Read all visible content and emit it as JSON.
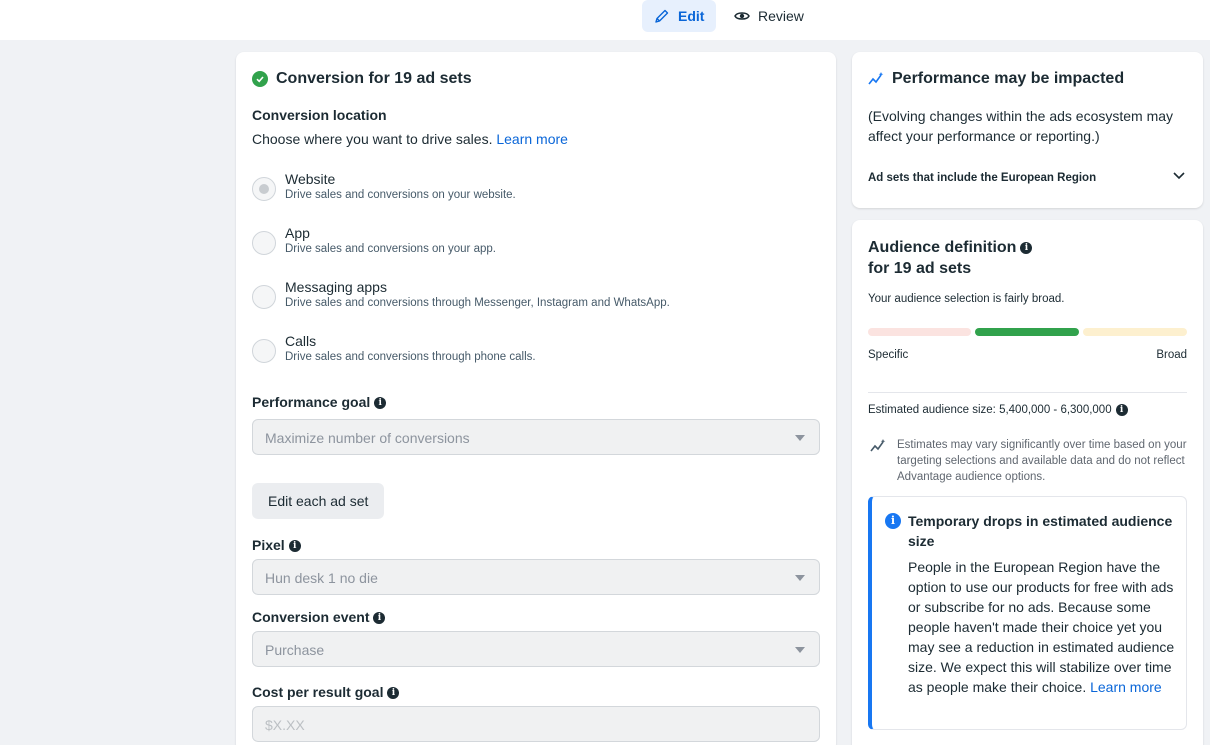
{
  "tabs": {
    "edit": "Edit",
    "review": "Review"
  },
  "conversion": {
    "header": "Conversion for 19 ad sets",
    "location_label": "Conversion location",
    "location_desc": "Choose where you want to drive sales.",
    "learn_more": "Learn more",
    "options": [
      {
        "title": "Website",
        "desc": "Drive sales and conversions on your website.",
        "selected": true
      },
      {
        "title": "App",
        "desc": "Drive sales and conversions on your app.",
        "selected": false
      },
      {
        "title": "Messaging apps",
        "desc": "Drive sales and conversions through Messenger, Instagram and WhatsApp.",
        "selected": false
      },
      {
        "title": "Calls",
        "desc": "Drive sales and conversions through phone calls.",
        "selected": false
      }
    ],
    "performance_goal_label": "Performance goal",
    "performance_goal_value": "Maximize number of conversions",
    "edit_each_button": "Edit each ad set",
    "pixel_label": "Pixel",
    "pixel_value": "Hun desk 1 no die",
    "conversion_event_label": "Conversion event",
    "conversion_event_value": "Purchase",
    "cost_goal_label": "Cost per result goal",
    "cost_goal_placeholder": "$X.XX"
  },
  "performance": {
    "title": "Performance may be impacted",
    "desc": "(Evolving changes within the ads ecosystem may affect your performance or reporting.)",
    "accordion": "Ad sets that include the European Region"
  },
  "audience": {
    "title_line1": "Audience definition",
    "title_line2": "for 19 ad sets",
    "selection_text": "Your audience selection is fairly broad.",
    "meter_level": "fairly broad",
    "specific_label": "Specific",
    "broad_label": "Broad",
    "estimated_label": "Estimated audience size:",
    "estimated_value": "5,400,000 - 6,300,000",
    "estimate_note": "Estimates may vary significantly over time based on your targeting selections and available data and do not reflect Advantage audience options.",
    "notice_title": "Temporary drops in estimated audience size",
    "notice_body": "People in the European Region have the option to use our products for free with ads or subscribe for no ads. Because some people haven't made their choice yet you may see a reduction in estimated audience size. We expect this will stabilize over time as people make their choice.",
    "notice_link": "Learn more"
  },
  "colors": {
    "accent": "#0a66d8",
    "success": "#31a24c",
    "meter_specific": "#fbe3e0",
    "meter_active": "#31a24c",
    "meter_broad": "#fdf0cf"
  }
}
